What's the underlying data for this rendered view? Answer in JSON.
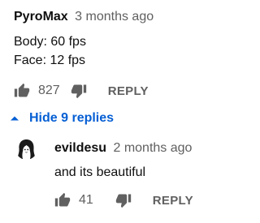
{
  "comment": {
    "author": "PyroMax",
    "time": "3 months ago",
    "body_lines": [
      "Body: 60 fps",
      "Face: 12 fps"
    ],
    "likes": "827",
    "reply_label": "REPLY"
  },
  "replies_toggle": {
    "label": "Hide 9 replies",
    "color": "#065fd4"
  },
  "reply": {
    "author": "evildesu",
    "time": "2 months ago",
    "body": "and its beautiful",
    "likes": "41",
    "reply_label": "REPLY"
  },
  "colors": {
    "text": "#0f0f0f",
    "secondary": "#606060",
    "accent": "#065fd4"
  },
  "icons": {
    "like": "thumbs-up-icon",
    "dislike": "thumbs-down-icon",
    "toggle": "caret-up-icon"
  }
}
